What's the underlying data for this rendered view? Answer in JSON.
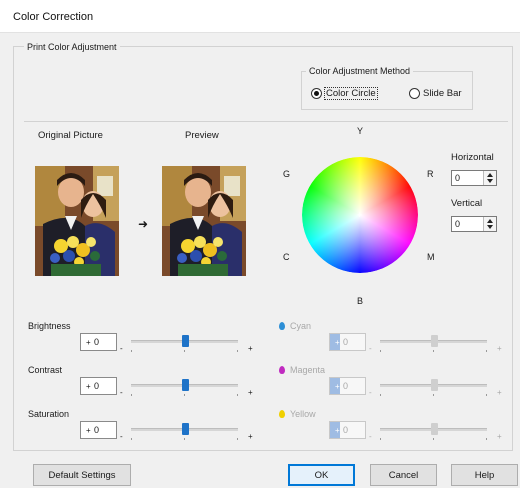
{
  "window": {
    "title": "Color Correction"
  },
  "group": {
    "label": "Print Color Adjustment"
  },
  "method": {
    "label": "Color Adjustment Method",
    "options": [
      {
        "label": "Color Circle",
        "selected": true
      },
      {
        "label": "Slide Bar",
        "selected": false
      }
    ]
  },
  "pictures": {
    "original_label": "Original Picture",
    "preview_label": "Preview"
  },
  "wheel": {
    "labels": {
      "top": "Y",
      "top_left": "G",
      "top_right": "R",
      "bottom_left": "C",
      "bottom_right": "M",
      "bottom": "B"
    },
    "horizontal": {
      "label": "Horizontal",
      "value": "0"
    },
    "vertical": {
      "label": "Vertical",
      "value": "0"
    }
  },
  "sliders": [
    {
      "label": "Brightness",
      "sign": "+",
      "value": "0",
      "minus": "-",
      "plus": "+",
      "level": 0
    },
    {
      "label": "Contrast",
      "sign": "+",
      "value": "0",
      "minus": "-",
      "plus": "+",
      "level": 0
    },
    {
      "label": "Saturation",
      "sign": "+",
      "value": "0",
      "minus": "-",
      "plus": "+",
      "level": 0
    }
  ],
  "color_sliders": [
    {
      "label": "Cyan",
      "sign": "+",
      "value": "0",
      "minus": "-",
      "plus": "+",
      "icon": "cyan-drop-icon",
      "color": "#2d8fd6",
      "disabled": true
    },
    {
      "label": "Magenta",
      "sign": "+",
      "value": "0",
      "minus": "-",
      "plus": "+",
      "icon": "magenta-drop-icon",
      "color": "#c02bc0",
      "disabled": true
    },
    {
      "label": "Yellow",
      "sign": "+",
      "value": "0",
      "minus": "-",
      "plus": "+",
      "icon": "yellow-drop-icon",
      "color": "#f0d000",
      "disabled": true
    }
  ],
  "buttons": {
    "default_settings": "Default Settings",
    "ok": "OK",
    "cancel": "Cancel",
    "help": "Help"
  },
  "colors": {
    "accent": "#0078d7",
    "thumb": "#1e73c8"
  }
}
